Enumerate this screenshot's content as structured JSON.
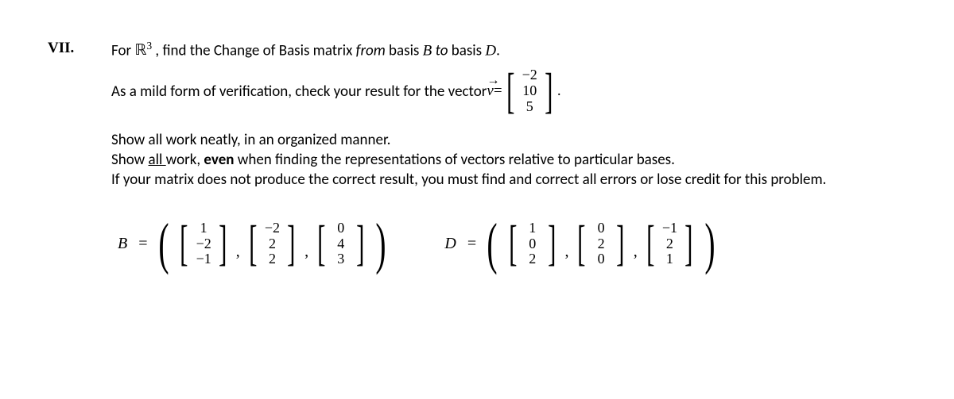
{
  "label": "VII.",
  "line1_a": "For ",
  "line1_R": "ℝ",
  "line1_sup": "3",
  "line1_b": " , find the Change of Basis matrix ",
  "line1_from": "from",
  "line1_c": " basis ",
  "line1_B": "B",
  "line1_to": " to",
  "line1_d": " basis ",
  "line1_D": "D",
  "line1_e": ".",
  "line2_a": "As a mild form of verification, check your result for the vector ",
  "line2_v": "v",
  "line2_eq": " = ",
  "line2_period": ".",
  "vec_v": [
    "−2",
    "10",
    "5"
  ],
  "line3": "Show all work neatly, in an organized manner.",
  "line4_a": "Show ",
  "line4_all": "all ",
  "line4_b": "work, ",
  "line4_even": "even",
  "line4_c": " when finding the representations of vectors relative to particular bases.",
  "line5": "If your matrix does not produce the correct result, you must find and correct all errors or lose credit for this problem.",
  "B_label": "B",
  "D_label": "D",
  "equals": " = ",
  "B1": [
    "1",
    "−2",
    "−1"
  ],
  "B2": [
    "−2",
    "2",
    "2"
  ],
  "B3": [
    "0",
    "4",
    "3"
  ],
  "D1": [
    "1",
    "0",
    "2"
  ],
  "D2": [
    "0",
    "2",
    "0"
  ],
  "D3": [
    "−1",
    "2",
    "1"
  ]
}
